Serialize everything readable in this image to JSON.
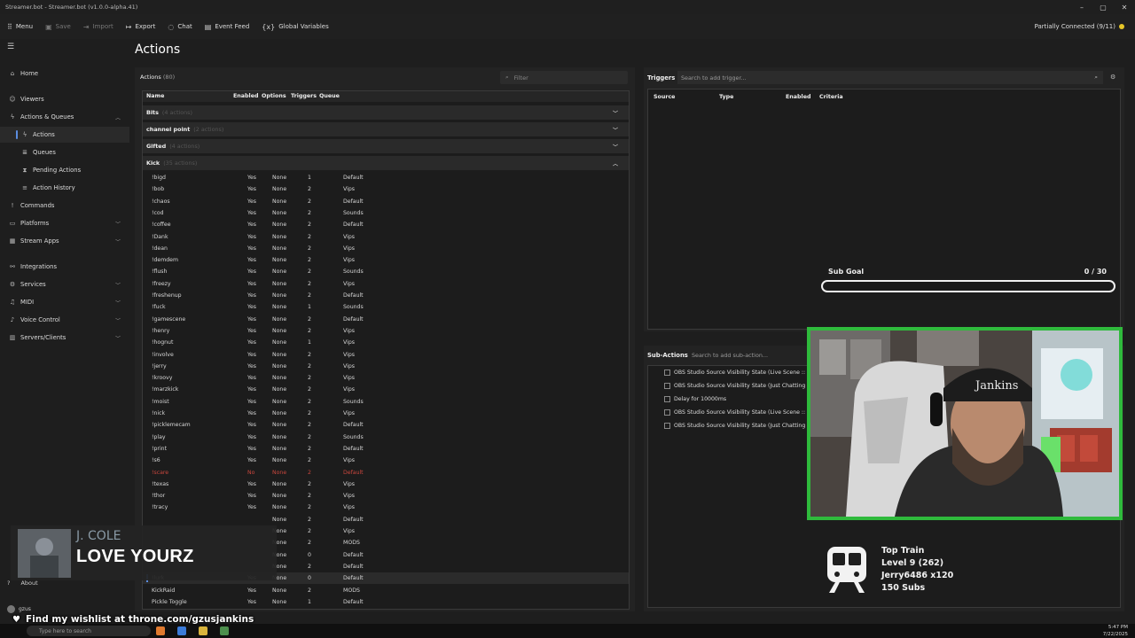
{
  "window": {
    "title": "Streamer.bot - Streamer.bot (v1.0.0-alpha.41)",
    "controls": [
      "–",
      "▢",
      "✕"
    ]
  },
  "toolbar": {
    "menu": "Menu",
    "save": "Save",
    "import": "Import",
    "export": "Export",
    "chat": "Chat",
    "event_feed": "Event Feed",
    "global_variables": "Global Variables",
    "status": "Partially Connected (9/11)"
  },
  "sidebar": {
    "home": "Home",
    "viewers": "Viewers",
    "actions_queues": "Actions & Queues",
    "actions": "Actions",
    "queues": "Queues",
    "pending_actions": "Pending Actions",
    "action_history": "Action History",
    "commands": "Commands",
    "platforms": "Platforms",
    "stream_apps": "Stream Apps",
    "integrations": "Integrations",
    "services": "Services",
    "midi": "MIDI",
    "voice_control": "Voice Control",
    "servers_clients": "Servers/Clients",
    "about": "About",
    "user": "gzus"
  },
  "main": {
    "page_title": "Actions",
    "actions_label": "Actions",
    "actions_count": "(80)",
    "filter_placeholder": "Filter",
    "columns": {
      "name": "Name",
      "enabled": "Enabled",
      "options": "Options",
      "triggers": "Triggers",
      "queue": "Queue"
    },
    "groups": [
      {
        "name": "Bits",
        "count": "(4 actions)"
      },
      {
        "name": "channel point",
        "count": "(2 actions)"
      },
      {
        "name": "Gifted",
        "count": "(4 actions)"
      },
      {
        "name": "Kick",
        "count": "(35 actions)"
      }
    ],
    "rows": [
      {
        "name": "!bigd",
        "enabled": "Yes",
        "options": "None",
        "triggers": "1",
        "queue": "Default"
      },
      {
        "name": "!bob",
        "enabled": "Yes",
        "options": "None",
        "triggers": "2",
        "queue": "Vips"
      },
      {
        "name": "!chaos",
        "enabled": "Yes",
        "options": "None",
        "triggers": "2",
        "queue": "Default"
      },
      {
        "name": "!cod",
        "enabled": "Yes",
        "options": "None",
        "triggers": "2",
        "queue": "Sounds"
      },
      {
        "name": "!coffee",
        "enabled": "Yes",
        "options": "None",
        "triggers": "2",
        "queue": "Default"
      },
      {
        "name": "!Dank",
        "enabled": "Yes",
        "options": "None",
        "triggers": "2",
        "queue": "Vips"
      },
      {
        "name": "!dean",
        "enabled": "Yes",
        "options": "None",
        "triggers": "2",
        "queue": "Vips"
      },
      {
        "name": "!demdem",
        "enabled": "Yes",
        "options": "None",
        "triggers": "2",
        "queue": "Vips"
      },
      {
        "name": "!flush",
        "enabled": "Yes",
        "options": "None",
        "triggers": "2",
        "queue": "Sounds"
      },
      {
        "name": "!freezy",
        "enabled": "Yes",
        "options": "None",
        "triggers": "2",
        "queue": "Vips"
      },
      {
        "name": "!freshenup",
        "enabled": "Yes",
        "options": "None",
        "triggers": "2",
        "queue": "Default"
      },
      {
        "name": "!fuck",
        "enabled": "Yes",
        "options": "None",
        "triggers": "1",
        "queue": "Sounds"
      },
      {
        "name": "!gamescene",
        "enabled": "Yes",
        "options": "None",
        "triggers": "2",
        "queue": "Default"
      },
      {
        "name": "!henry",
        "enabled": "Yes",
        "options": "None",
        "triggers": "2",
        "queue": "Vips"
      },
      {
        "name": "!hognut",
        "enabled": "Yes",
        "options": "None",
        "triggers": "1",
        "queue": "Vips"
      },
      {
        "name": "!involve",
        "enabled": "Yes",
        "options": "None",
        "triggers": "2",
        "queue": "Vips"
      },
      {
        "name": "!jerry",
        "enabled": "Yes",
        "options": "None",
        "triggers": "2",
        "queue": "Vips"
      },
      {
        "name": "!kroovy",
        "enabled": "Yes",
        "options": "None",
        "triggers": "2",
        "queue": "Vips"
      },
      {
        "name": "!marzkick",
        "enabled": "Yes",
        "options": "None",
        "triggers": "2",
        "queue": "Vips"
      },
      {
        "name": "!moist",
        "enabled": "Yes",
        "options": "None",
        "triggers": "2",
        "queue": "Sounds"
      },
      {
        "name": "!nick",
        "enabled": "Yes",
        "options": "None",
        "triggers": "2",
        "queue": "Vips"
      },
      {
        "name": "!picklemecam",
        "enabled": "Yes",
        "options": "None",
        "triggers": "2",
        "queue": "Default"
      },
      {
        "name": "!play",
        "enabled": "Yes",
        "options": "None",
        "triggers": "2",
        "queue": "Sounds"
      },
      {
        "name": "!print",
        "enabled": "Yes",
        "options": "None",
        "triggers": "2",
        "queue": "Default"
      },
      {
        "name": "!s6",
        "enabled": "Yes",
        "options": "None",
        "triggers": "2",
        "queue": "Vips"
      },
      {
        "name": "!scare",
        "enabled": "No",
        "options": "None",
        "triggers": "2",
        "queue": "Default"
      },
      {
        "name": "!texas",
        "enabled": "Yes",
        "options": "None",
        "triggers": "2",
        "queue": "Vips"
      },
      {
        "name": "!thor",
        "enabled": "Yes",
        "options": "None",
        "triggers": "2",
        "queue": "Vips"
      },
      {
        "name": "!tracy",
        "enabled": "Yes",
        "options": "None",
        "triggers": "2",
        "queue": "Vips"
      },
      {
        "name": "",
        "enabled": "",
        "options": "None",
        "triggers": "2",
        "queue": "Default"
      },
      {
        "name": "",
        "enabled": "",
        "options": "None",
        "triggers": "2",
        "queue": "Vips"
      },
      {
        "name": "",
        "enabled": "",
        "options": "None",
        "triggers": "2",
        "queue": "MODS"
      },
      {
        "name": "",
        "enabled": "",
        "options": "None",
        "triggers": "0",
        "queue": "Default"
      },
      {
        "name": "",
        "enabled": "",
        "options": "None",
        "triggers": "2",
        "queue": "Default"
      },
      {
        "name": "!lurk",
        "enabled": "Yes",
        "options": "None",
        "triggers": "0",
        "queue": "Default"
      },
      {
        "name": "KickRaid",
        "enabled": "Yes",
        "options": "None",
        "triggers": "2",
        "queue": "MODS"
      },
      {
        "name": "Pickle Toggle",
        "enabled": "Yes",
        "options": "None",
        "triggers": "1",
        "queue": "Default"
      }
    ]
  },
  "triggers": {
    "title": "Triggers",
    "search_placeholder": "Search to add trigger...",
    "columns": {
      "source": "Source",
      "type": "Type",
      "enabled": "Enabled",
      "criteria": "Criteria"
    }
  },
  "sub_goal": {
    "label": "Sub Goal",
    "value": "0 / 30",
    "progress_fraction": 0
  },
  "sub_actions": {
    "title": "Sub-Actions",
    "search_placeholder": "Search to add sub-action...",
    "items": [
      "OBS Studio Source Visibility State (Live Scene :: Lurk",
      "OBS Studio Source Visibility State (Just Chatting :: Lu",
      "Delay for 10000ms",
      "OBS Studio Source Visibility State (Live Scene :: Lurk",
      "OBS Studio Source Visibility State (Just Chatting :: Lu"
    ]
  },
  "train": {
    "title": "Top Train",
    "level": "Level 9  (262)",
    "user": "Jerry6486 x120",
    "subs": "150 Subs"
  },
  "now_playing": {
    "artist": "J. COLE",
    "song": "LOVE YOURZ"
  },
  "wishlist": "Find my wishlist at throne.com/gzusjankins",
  "taskbar": {
    "search_placeholder": "Type here to search",
    "time": "5:47 PM",
    "date": "7/22/2025"
  },
  "webcam": {
    "cap_text": "Jankins"
  },
  "colors": {
    "accent": "#5b8de0",
    "status_dot": "#e6c628",
    "webcam_border": "#2fba3c",
    "disabled_row": "#c9463d"
  }
}
